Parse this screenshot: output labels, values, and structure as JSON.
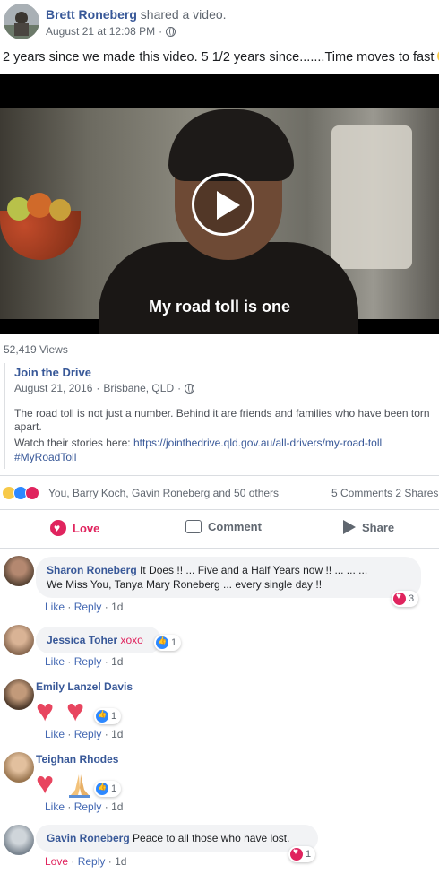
{
  "post": {
    "author": "Brett Roneberg",
    "action": "shared a video.",
    "date": "August 21 at 12:08 PM",
    "meta_separator": "·",
    "text": "2 years since we made this video. 5 1/2 years since.......Time moves to fast"
  },
  "video": {
    "subtitle": "My road toll is one",
    "views": "52,419 Views"
  },
  "shared": {
    "page_name": "Join the Drive",
    "date": "August 21, 2016",
    "location": "Brisbane, QLD",
    "description": "The road toll is not just a number. Behind it are friends and families who have been torn apart.",
    "link_prefix": "Watch their stories here:",
    "link": "https://jointhedrive.qld.gov.au/all-drivers/my-road-toll",
    "hashtag": "#MyRoadToll"
  },
  "reactions": {
    "names": "You, Barry Koch, Gavin Roneberg and 50 others",
    "comments_count": "5 Comments",
    "shares_count": "2 Shares"
  },
  "actions": {
    "love": "Love",
    "comment": "Comment",
    "share": "Share"
  },
  "comments": [
    {
      "name": "Sharon Roneberg",
      "text": "It Does !! ... Five and a Half Years now !! ... ... ...",
      "text2": "We Miss You, Tanya Mary Roneberg ... every single day !!",
      "like": "Like",
      "reply": "Reply",
      "time": "1d",
      "reaction_count": "3"
    },
    {
      "name": "Jessica Toher",
      "text": "xoxo",
      "like": "Like",
      "reply": "Reply",
      "time": "1d",
      "reaction_count": "1"
    },
    {
      "name": "Emily Lanzel Davis",
      "like": "Like",
      "reply": "Reply",
      "time": "1d",
      "reaction_count": "1"
    },
    {
      "name": "Teighan Rhodes",
      "like": "Like",
      "reply": "Reply",
      "time": "1d",
      "reaction_count": "1"
    },
    {
      "name": "Gavin Roneberg",
      "text": "Peace to all those who have lost.",
      "like": "Love",
      "reply": "Reply",
      "time": "1d",
      "reaction_count": "1"
    }
  ],
  "separator": "·",
  "colors": {
    "link": "#385898",
    "love": "#e0245e",
    "like": "#2d88ff",
    "muted": "#606770"
  }
}
